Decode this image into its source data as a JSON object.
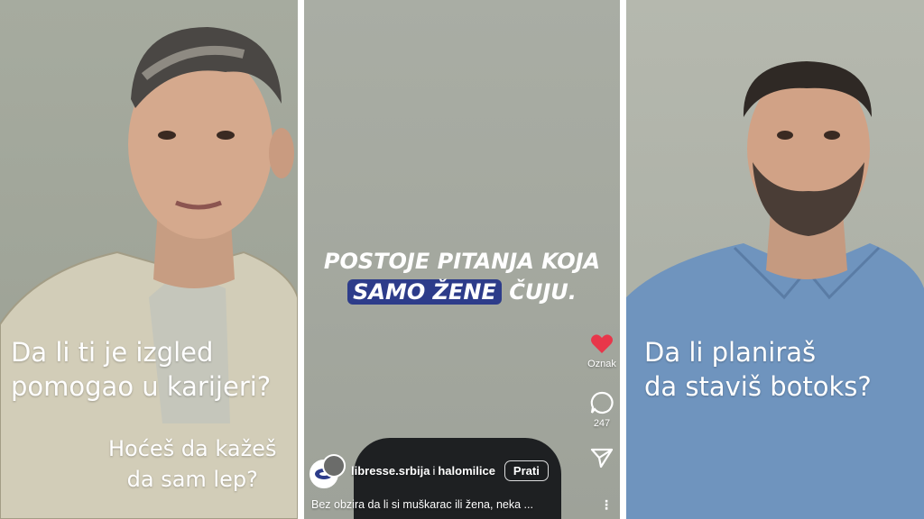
{
  "left_panel": {
    "question_lines": [
      "Da li ti je izgled",
      "pomogao u karijeri?"
    ],
    "answer_lines": [
      "Hoćeš da kažeš",
      "da sam lep?"
    ]
  },
  "middle_panel": {
    "headline_line1": "POSTOJE PITANJA KOJA",
    "headline_highlight": "SAMO ŽENE",
    "headline_rest": " ČUJU.",
    "like_label": "Oznak",
    "comment_count": "247",
    "account_primary": "libresse.srbija",
    "account_joiner": "i",
    "account_secondary": "halomilice",
    "follow_label": "Prati",
    "post_caption": "Bez obzira da li si muškarac ili žena, neka ...",
    "more_label": "⋮",
    "brand_color": "#2d3c8a",
    "like_color": "#e8364a"
  },
  "right_panel": {
    "question_lines": [
      "Da li planiraš",
      "da staviš botoks?"
    ]
  }
}
